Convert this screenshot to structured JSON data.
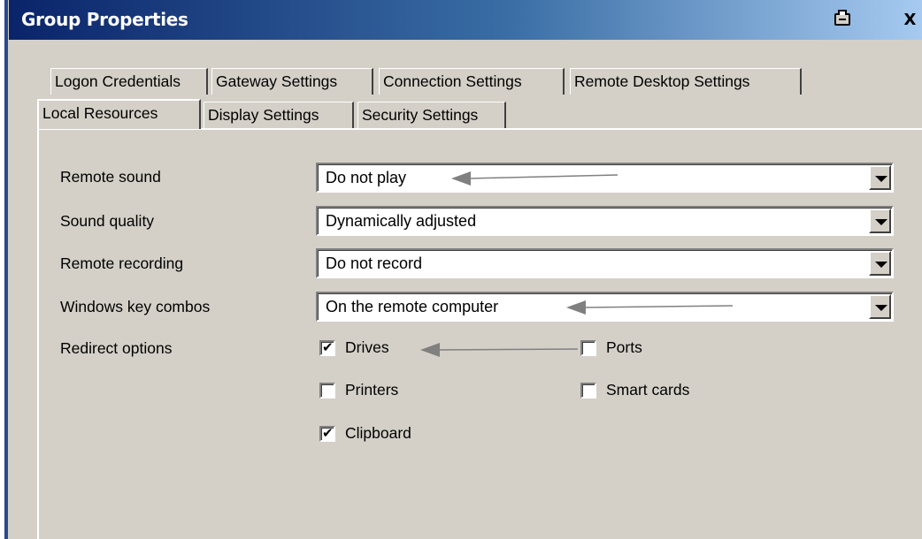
{
  "window": {
    "title": "Group Properties",
    "print_icon": "printer-icon",
    "close_label": "X"
  },
  "tabs": {
    "row1": [
      "Logon Credentials",
      "Gateway Settings",
      "Connection Settings",
      "Remote Desktop Settings"
    ],
    "row2": [
      "Local Resources",
      "Display Settings",
      "Security Settings"
    ],
    "active": "Local Resources"
  },
  "fields": {
    "remote_sound": {
      "label": "Remote sound",
      "value": "Do not play"
    },
    "sound_quality": {
      "label": "Sound quality",
      "value": "Dynamically adjusted"
    },
    "remote_recording": {
      "label": "Remote recording",
      "value": "Do not record"
    },
    "windows_key_combos": {
      "label": "Windows key combos",
      "value": "On the remote computer"
    }
  },
  "redirect": {
    "label": "Redirect options",
    "drives": {
      "label": "Drives",
      "checked": true
    },
    "ports": {
      "label": "Ports",
      "checked": false
    },
    "printers": {
      "label": "Printers",
      "checked": false
    },
    "smart_cards": {
      "label": "Smart cards",
      "checked": false
    },
    "clipboard": {
      "label": "Clipboard",
      "checked": true
    },
    "check_glyph": "✔"
  },
  "colors": {
    "title_start": "#0a246a",
    "title_end": "#a6caf0",
    "face": "#d4d0c8",
    "annotation_arrow": "#808080"
  }
}
